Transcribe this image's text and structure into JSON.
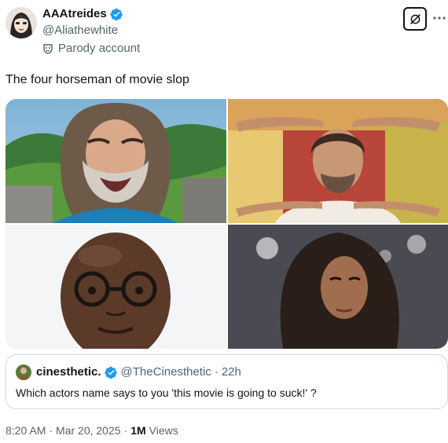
{
  "author": {
    "display_name": "AAAtreides",
    "handle": "@Aliathewhite",
    "label": "Parody account",
    "verified": true
  },
  "tweet": {
    "text": "The four horseman of movie slop"
  },
  "quoted_tweet": {
    "display_name": "cinesthetic.",
    "handle": "@TheCinesthetic",
    "separator": "·",
    "time": "22h",
    "text": "Which actors name says to you 'this movie is going to suck!' ?",
    "verified": true
  },
  "meta": {
    "time": "8:20 AM",
    "separator1": "·",
    "date": "Mar 20, 2025",
    "separator2": "·",
    "views_count": "1M",
    "views_label": "Views"
  },
  "icons": {
    "verified": "verified-badge-icon",
    "parody": "parody-mask-icon",
    "grok": "grok-icon",
    "more": "more-dots-icon"
  },
  "colors": {
    "verified_blue": "#1d9bf0",
    "text_primary": "#0f1419",
    "text_secondary": "#536471",
    "border": "#cfd9de"
  }
}
